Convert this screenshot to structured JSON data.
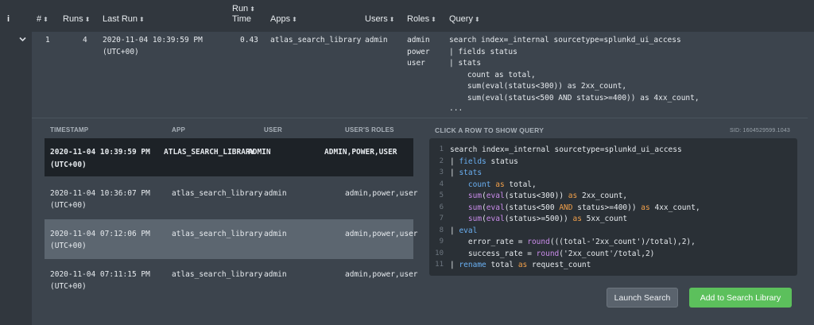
{
  "header": {
    "info": "i",
    "num": "#",
    "runs": "Runs",
    "last_run": "Last Run",
    "run_time_1": "Run",
    "run_time_2": "Time",
    "apps": "Apps",
    "users": "Users",
    "roles": "Roles",
    "query": "Query",
    "sort_glyph": "⬍"
  },
  "row": {
    "num": "1",
    "runs": "4",
    "last_run_1": "2020-11-04 10:39:59 PM",
    "last_run_2": "(UTC+00)",
    "run_time": "0.43",
    "app": "atlas_search_library",
    "user": "admin",
    "roles": [
      "admin",
      "power",
      "user"
    ],
    "query_lines": [
      "search index=_internal sourcetype=splunkd_ui_access",
      "| fields status",
      "| stats",
      "    count as total,",
      "    sum(eval(status<300)) as 2xx_count,",
      "    sum(eval(status<500 AND status>=400)) as 4xx_count,",
      "..."
    ]
  },
  "history": {
    "columns": [
      "TIMESTAMP",
      "APP",
      "USER",
      "USER'S ROLES"
    ],
    "rows": [
      {
        "ts1": "2020-11-04 10:39:59 PM",
        "ts2": "(UTC+00)",
        "app": "ATLAS_SEARCH_LIBRARY",
        "user": "ADMIN",
        "roles": "ADMIN,POWER,USER",
        "state": "selected"
      },
      {
        "ts1": "2020-11-04 10:36:07 PM",
        "ts2": "(UTC+00)",
        "app": "atlas_search_library",
        "user": "admin",
        "roles": "admin,power,user",
        "state": "normal"
      },
      {
        "ts1": "2020-11-04 07:12:06 PM",
        "ts2": "(UTC+00)",
        "app": "atlas_search_library",
        "user": "admin",
        "roles": "admin,power,user",
        "state": "hover"
      },
      {
        "ts1": "2020-11-04 07:11:15 PM",
        "ts2": "(UTC+00)",
        "app": "atlas_search_library",
        "user": "admin",
        "roles": "admin,power,user",
        "state": "normal"
      }
    ]
  },
  "query_panel": {
    "title": "CLICK A ROW TO SHOW QUERY",
    "sid": "SID: 1604529599.1043",
    "line_numbers": [
      "1",
      "2",
      "3",
      "4",
      "5",
      "6",
      "7",
      "8",
      "9",
      "10",
      "11"
    ]
  },
  "buttons": {
    "launch": "Launch Search",
    "add": "Add to Search Library"
  },
  "colors": {
    "selected_row": "#1d2227",
    "hover_row": "#5c6670",
    "add_button": "#5cc05c",
    "keyword": "#6ab0f3",
    "function": "#c98bea",
    "operator": "#f2a04a"
  }
}
